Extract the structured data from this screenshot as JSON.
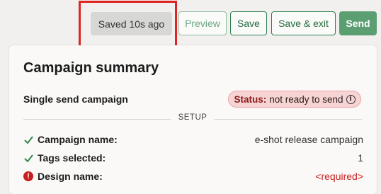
{
  "toolbar": {
    "saved_status": "Saved 10s ago",
    "preview_label": "Preview",
    "save_label": "Save",
    "save_exit_label": "Save & exit",
    "send_label": "Send"
  },
  "summary": {
    "title": "Campaign summary",
    "campaign_type": "Single send campaign",
    "status_label": "Status:",
    "status_value": "not ready to send",
    "section_label": "SETUP",
    "rows": [
      {
        "label": "Campaign name:",
        "value": "e-shot release campaign",
        "state": "complete"
      },
      {
        "label": "Tags selected:",
        "value": "1",
        "state": "complete"
      },
      {
        "label": "Design name:",
        "value": "<required>",
        "state": "required"
      }
    ]
  },
  "colors": {
    "accent_green": "#2f7d4f",
    "send_green": "#5a9e72",
    "error_red": "#c81e1e",
    "highlight_red": "#e02424"
  }
}
